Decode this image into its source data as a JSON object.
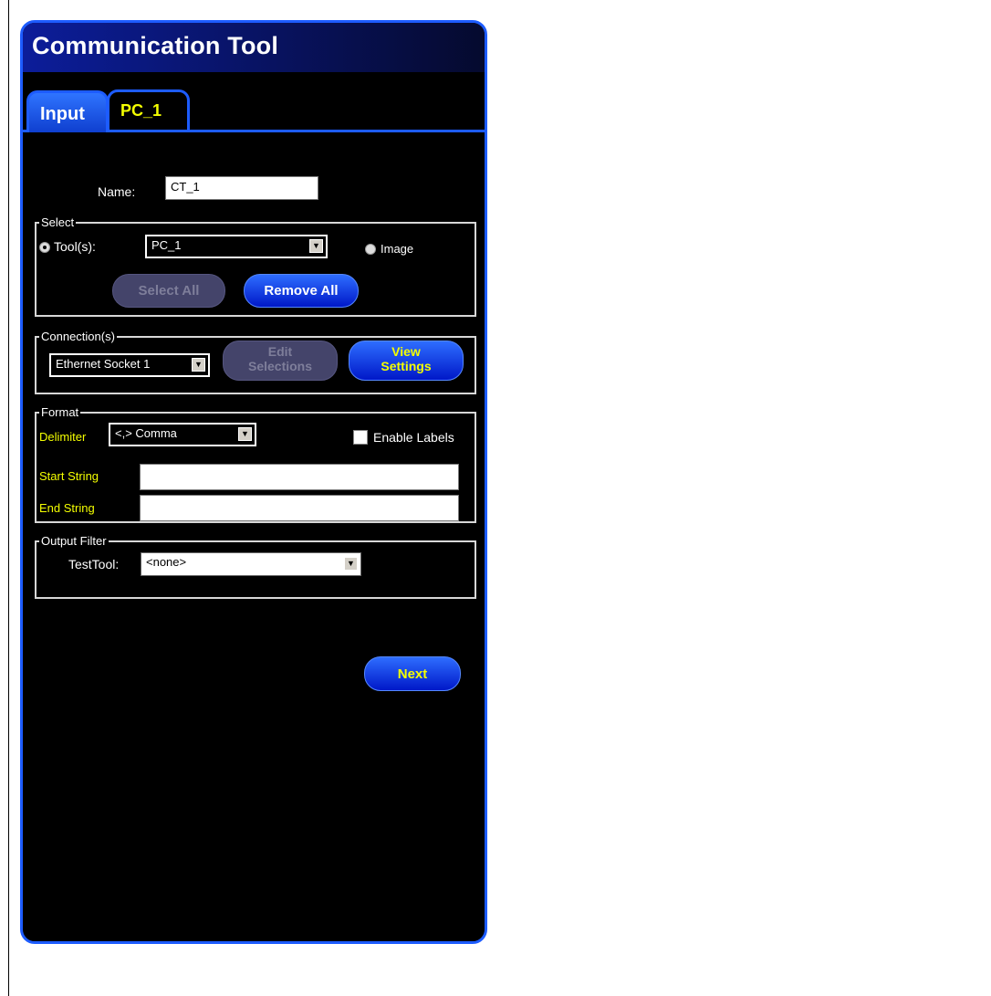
{
  "window": {
    "title": "Communication Tool"
  },
  "tabs": [
    {
      "label": "Input",
      "selected": true
    },
    {
      "label": "PC_1",
      "selected": false
    }
  ],
  "name_field": {
    "label": "Name:",
    "value": "CT_1"
  },
  "select_group": {
    "label": "Select",
    "tools_label": "Tool(s):",
    "tools_value": "PC_1",
    "image_label": "Image",
    "select_all_label": "Select All",
    "remove_all_label": "Remove All"
  },
  "connections_group": {
    "label": "Connection(s)",
    "connection_value": "Ethernet Socket 1",
    "edit_line1": "Edit",
    "edit_line2": "Selections",
    "view_line1": "View",
    "view_line2": "Settings"
  },
  "format_group": {
    "label": "Format",
    "delimiter_label": "Delimiter",
    "delimiter_value": "<,> Comma",
    "enable_labels_label": "Enable Labels",
    "start_string_label": "Start String",
    "start_string_value": "",
    "end_string_label": "End  String",
    "end_string_value": ""
  },
  "output_filter": {
    "label": "Output Filter",
    "testtool_label": "TestTool:",
    "testtool_value": "<none>"
  },
  "next_button": {
    "label": "Next"
  },
  "colors": {
    "panel_border": "#1d5cff",
    "accent_yellow": "#f4ff00",
    "button_blue": "#1b44e6"
  }
}
